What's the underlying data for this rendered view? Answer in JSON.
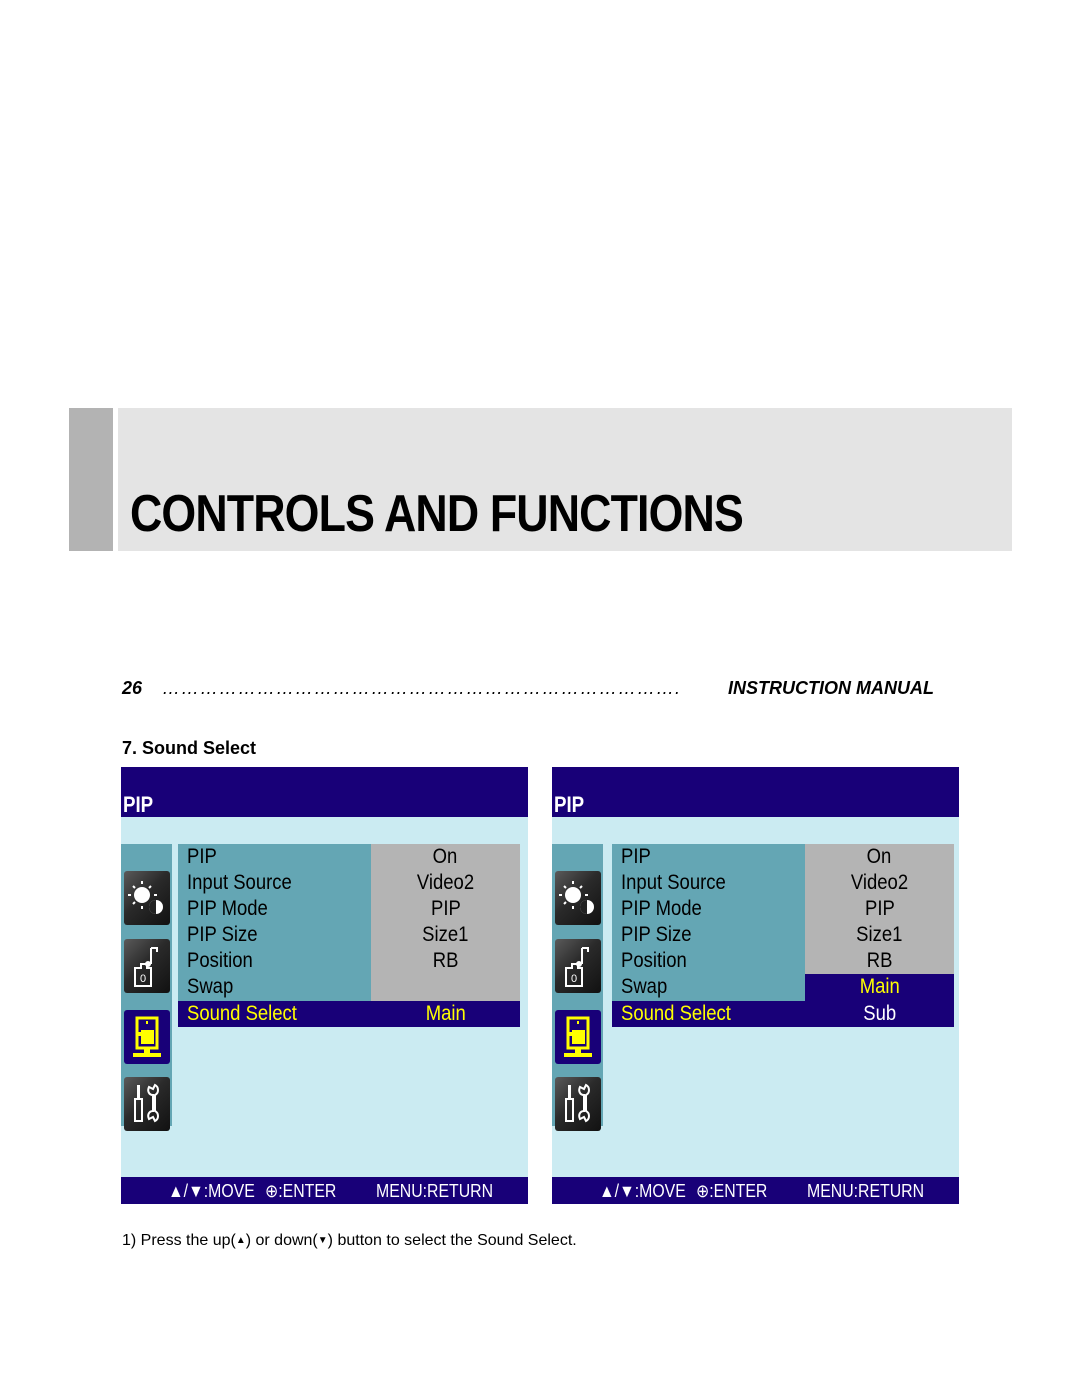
{
  "chapter": {
    "title": "CONTROLS AND FUNCTIONS"
  },
  "header": {
    "page_number": "26",
    "dots": "……………………………………………………………………….",
    "manual_title": "INSTRUCTION MANUAL"
  },
  "section": {
    "title": "7. Sound Select"
  },
  "screens": [
    {
      "title": "PIP",
      "sidebar_icons": [
        "picture-icon",
        "sound-icon",
        "pip-icon",
        "setup-icon"
      ],
      "active_icon": "pip-icon",
      "rows": [
        {
          "label": "PIP",
          "value": "On"
        },
        {
          "label": "Input Source",
          "value": "Video2"
        },
        {
          "label": "PIP Mode",
          "value": "PIP"
        },
        {
          "label": "PIP Size",
          "value": "Size1"
        },
        {
          "label": "Position",
          "value": "RB"
        },
        {
          "label": "Swap",
          "value": ""
        },
        {
          "label": "Sound Select",
          "value": "Main"
        }
      ],
      "selected_row": "Sound Select",
      "footer": {
        "move": "▲/▼:MOVE",
        "enter": "⊕:ENTER",
        "return": "MENU:RETURN"
      }
    },
    {
      "title": "PIP",
      "sidebar_icons": [
        "picture-icon",
        "sound-icon",
        "pip-icon",
        "setup-icon"
      ],
      "active_icon": "pip-icon",
      "rows": [
        {
          "label": "PIP",
          "value": "On"
        },
        {
          "label": "Input Source",
          "value": "Video2"
        },
        {
          "label": "PIP Mode",
          "value": "PIP"
        },
        {
          "label": "PIP Size",
          "value": "Size1"
        },
        {
          "label": "Position",
          "value": "RB"
        },
        {
          "label": "Swap",
          "value": "Main"
        },
        {
          "label": "Sound Select",
          "value": "Sub"
        }
      ],
      "selected_row": "Sound Select",
      "dropdown_options": [
        "Main",
        "Sub"
      ],
      "highlighted_option": "Main",
      "footer": {
        "move": "▲/▼:MOVE",
        "enter": "⊕:ENTER",
        "return": "MENU:RETURN"
      }
    }
  ],
  "instruction": {
    "prefix": "1) Press the up(",
    "up_symbol": "▲",
    "middle": ") or down(",
    "down_symbol": "▼",
    "suffix": ") button to select the Sound Select."
  },
  "colors": {
    "osd_navy": "#180078",
    "osd_bg": "#cbebf2",
    "label_col": "#64a6b4",
    "value_col": "#b4b4b4",
    "highlight_text": "#ffff00"
  }
}
